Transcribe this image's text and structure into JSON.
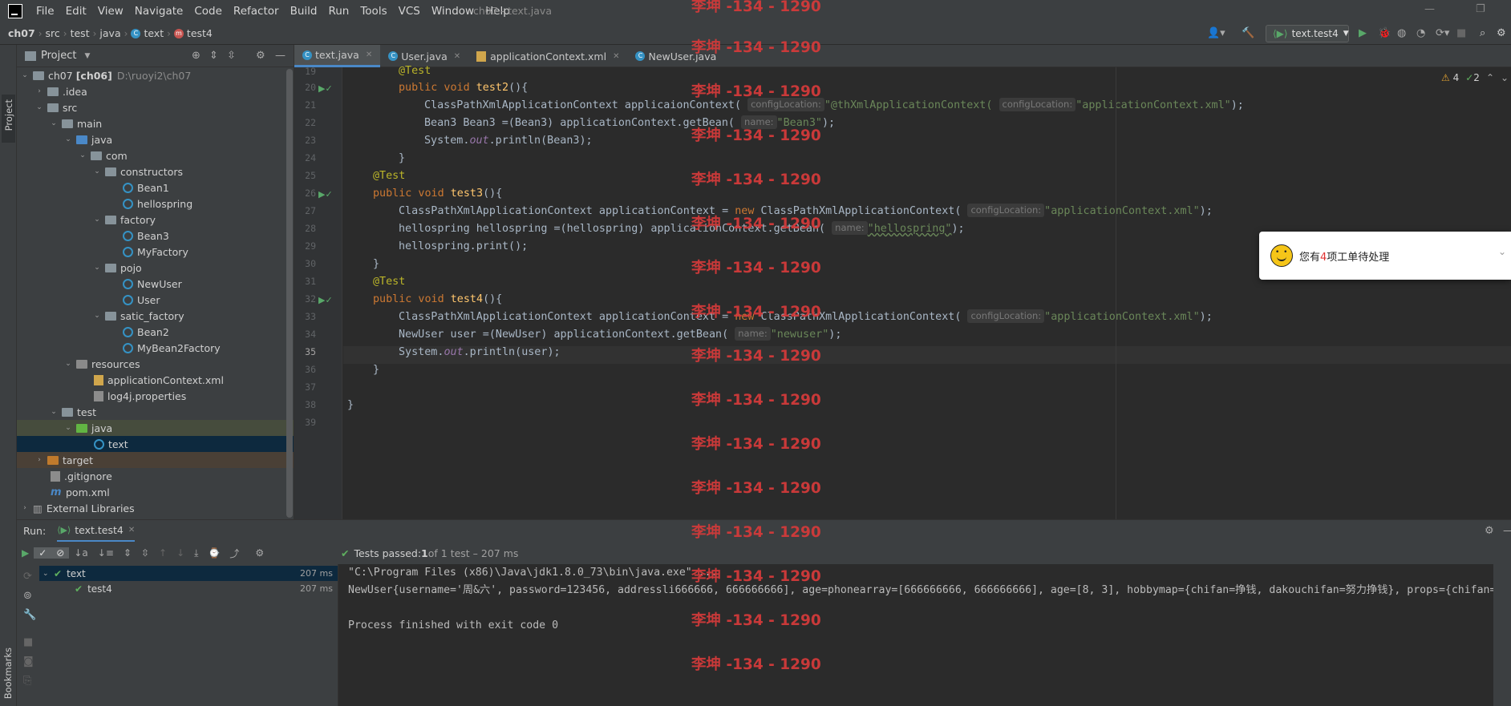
{
  "menubar": {
    "items": [
      "File",
      "Edit",
      "View",
      "Navigate",
      "Code",
      "Refactor",
      "Build",
      "Run",
      "Tools",
      "VCS",
      "Window",
      "Help"
    ],
    "window_title": "ch07 - text.java"
  },
  "navbar": {
    "crumbs": [
      "ch07",
      "src",
      "test",
      "java",
      "text",
      "test4"
    ],
    "run_config": "text.test4"
  },
  "stripe": {
    "project": "Project",
    "bookmarks": "Bookmarks"
  },
  "project_panel": {
    "title": "Project",
    "tree": [
      {
        "label": "ch07",
        "extra": "[ch06]",
        "path": "D:\\ruoyi2\\ch07"
      },
      {
        "label": ".idea"
      },
      {
        "label": "src"
      },
      {
        "label": "main"
      },
      {
        "label": "java"
      },
      {
        "label": "com"
      },
      {
        "label": "constructors"
      },
      {
        "label": "Bean1"
      },
      {
        "label": "hellospring"
      },
      {
        "label": "factory"
      },
      {
        "label": "Bean3"
      },
      {
        "label": "MyFactory"
      },
      {
        "label": "pojo"
      },
      {
        "label": "NewUser"
      },
      {
        "label": "User"
      },
      {
        "label": "satic_factory"
      },
      {
        "label": "Bean2"
      },
      {
        "label": "MyBean2Factory"
      },
      {
        "label": "resources"
      },
      {
        "label": "applicationContext.xml"
      },
      {
        "label": "log4j.properties"
      },
      {
        "label": "test"
      },
      {
        "label": "java"
      },
      {
        "label": "text"
      },
      {
        "label": "target"
      },
      {
        "label": ".gitignore"
      },
      {
        "label": "pom.xml"
      },
      {
        "label": "External Libraries"
      }
    ]
  },
  "editor": {
    "tabs": [
      "text.java",
      "User.java",
      "applicationContext.xml",
      "NewUser.java"
    ],
    "line_numbers": [
      "19",
      "20",
      "21",
      "22",
      "23",
      "24",
      "25",
      "26",
      "27",
      "28",
      "29",
      "30",
      "31",
      "32",
      "33",
      "34",
      "35",
      "36",
      "37",
      "38",
      "39"
    ],
    "warnings": "4",
    "ok_count": "2",
    "hint_config": "configLocation:",
    "hint_name": "name:",
    "code": {
      "l19": "@Test",
      "l20a": "public void ",
      "l20b": "test2",
      "l20c": "(){",
      "l21a": "ClassPathXmlApplicationContext applica",
      "l21b": "ionContext(",
      "l21c": "\"@thXmlApplicationContext(",
      "l21d": "\"applicationContext.xml\"",
      "l21e": ");",
      "l22a": "Bean3 Bean3 =(Bean3) applicationContext.getBean(",
      "l22b": "\"Bean3\"",
      "l22c": ");",
      "l23a": "System.",
      "l23b": "out",
      "l23c": ".println(Bean3);",
      "l24": "}",
      "l25": "@Test",
      "l26a": "public void ",
      "l26b": "test3",
      "l26c": "(){",
      "l27a": "ClassPathXmlApplicationContext applicationContext = ",
      "l27b": "new ",
      "l27c": "ClassPathXmlApplicationContext(",
      "l27d": "\"applicationContext.xml\"",
      "l27e": ");",
      "l28a": "hellospring hellospring =(hellospring) applicationContext.getBean(",
      "l28b": "\"hellospring\"",
      "l28c": ");",
      "l29": "hellospring.print();",
      "l30": "}",
      "l31": "@Test",
      "l32a": "public void ",
      "l32b": "test4",
      "l32c": "(){",
      "l33a": "ClassPathXmlApplicationContext applicationContext = ",
      "l33b": "new ",
      "l33c": "ClassPathXmlApplicationContext(",
      "l33d": "\"applicationContext.xml\"",
      "l33e": ");",
      "l34a": "NewUser ",
      "l34b": "user",
      "l34c": " =(NewUser) applicationContext.getBean(",
      "l34d": "\"newuser\"",
      "l34e": ");",
      "l35a": "System.",
      "l35b": "out",
      "l35c": ".println(",
      "l35d": "user",
      "l35e": ");",
      "l36": "}",
      "l38": "}"
    }
  },
  "notification": {
    "prefix": "您有",
    "count": "4",
    "suffix": "项工单待处理"
  },
  "watermark": "李坤 -134 - 1290",
  "run_panel": {
    "label": "Run:",
    "tab": "text.test4",
    "status_prefix": "Tests passed: ",
    "status_count": "1",
    "status_suffix": " of 1 test – 207 ms",
    "tests": [
      {
        "name": "text",
        "time": "207 ms"
      },
      {
        "name": "test4",
        "time": "207 ms"
      }
    ],
    "console": [
      "\"C:\\Program Files (x86)\\Java\\jdk1.8.0_73\\bin\\java.exe\" ...",
      "NewUser{username='周&六', password=123456, addressli666666, 666666666], age=phonearray=[666666666, 666666666], age=[8, 3], hobbymap={chifan=挣钱, dakouchifan=努力挣钱}, props={chifan=挣",
      "",
      "Process finished with exit code 0"
    ]
  },
  "colors": {
    "accent": "#4a88c7",
    "watermark": "#d23a3a",
    "pass": "#5fb05f"
  }
}
